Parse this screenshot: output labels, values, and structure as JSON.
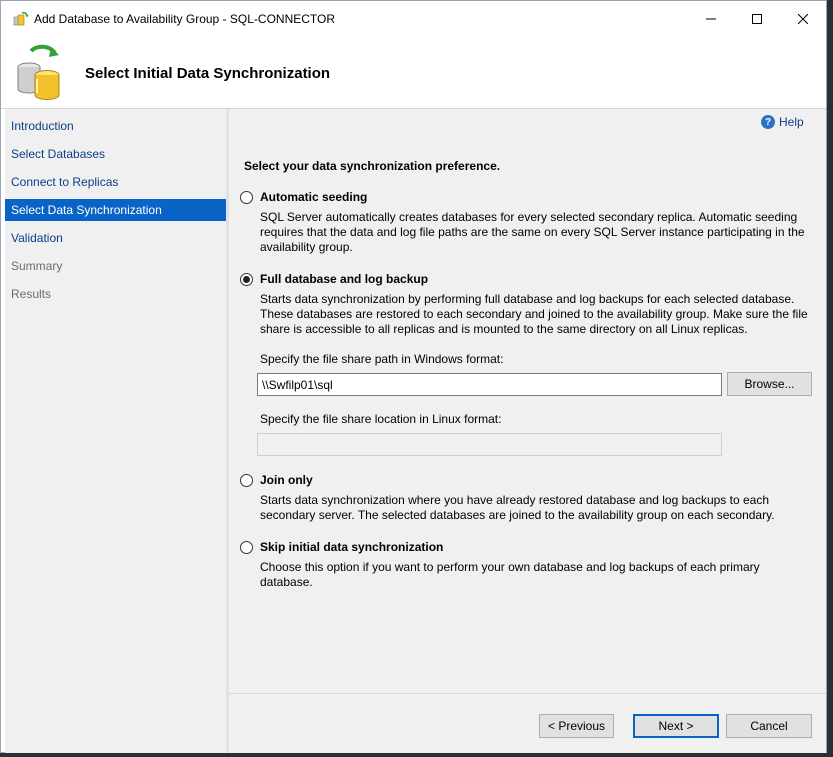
{
  "window": {
    "title": "Add Database to Availability Group - SQL-CONNECTOR"
  },
  "header": {
    "title": "Select Initial Data Synchronization"
  },
  "sidebar": {
    "items": [
      {
        "label": "Introduction",
        "state": "normal"
      },
      {
        "label": "Select Databases",
        "state": "normal"
      },
      {
        "label": "Connect to Replicas",
        "state": "normal"
      },
      {
        "label": "Select Data Synchronization",
        "state": "active"
      },
      {
        "label": "Validation",
        "state": "normal"
      },
      {
        "label": "Summary",
        "state": "disabled"
      },
      {
        "label": "Results",
        "state": "disabled"
      }
    ]
  },
  "main": {
    "help_label": "Help",
    "preference_label": "Select your data synchronization preference.",
    "options": [
      {
        "label": "Automatic seeding",
        "checked": false,
        "description": "SQL Server automatically creates databases for every selected secondary replica. Automatic seeding requires that the data and log file paths are the same on every SQL Server instance participating in the availability group."
      },
      {
        "label": "Full database and log backup",
        "checked": true,
        "description": "Starts data synchronization by performing full database and log backups for each selected database. These databases are restored to each secondary and joined to the availability group. Make sure the file share is accessible to all replicas and is mounted to the same directory on all Linux replicas."
      },
      {
        "label": "Join only",
        "checked": false,
        "description": "Starts data synchronization where you have already restored database and log backups to each secondary server. The selected databases are joined to the availability group on each secondary."
      },
      {
        "label": "Skip initial data synchronization",
        "checked": false,
        "description": "Choose this option if you want to perform your own database and log backups of each primary database."
      }
    ],
    "windows_path_label": "Specify the file share path in Windows format:",
    "windows_path_value": "\\\\Swfilp01\\sql",
    "browse_label": "Browse...",
    "linux_path_label": "Specify the file share location in Linux format:",
    "linux_path_value": ""
  },
  "footer": {
    "previous_label": "< Previous",
    "next_label": "Next >",
    "cancel_label": "Cancel"
  },
  "colors": {
    "accent": "#0a64c8",
    "link": "#0c3d8a",
    "panel": "#f0f0f0"
  }
}
